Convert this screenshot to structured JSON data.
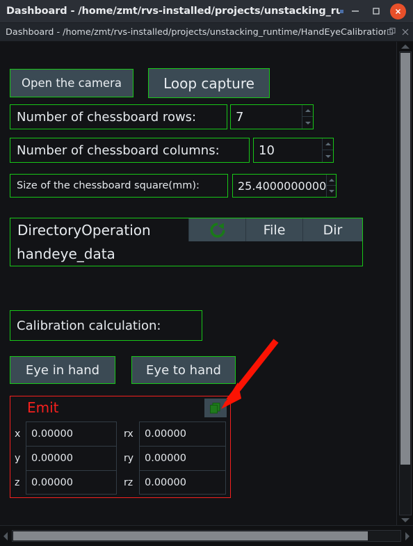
{
  "window": {
    "title": "Dashboard - /home/zmt/rvs-installed/projects/unstacking_runtime/...",
    "minimize_label": "minimize",
    "maximize_label": "maximize",
    "close_label": "close"
  },
  "dock": {
    "title": "Dashboard - /home/zmt/rvs-installed/projects/unstacking_runtime/HandEyeCalibration/Hand...",
    "float_label": "float",
    "close_label": "close"
  },
  "panel": {
    "open_camera_button": "Open the camera",
    "loop_capture_button": "Loop capture",
    "rows_label": "Number of chessboard rows:",
    "rows_value": "7",
    "columns_label": "Number of chessboard columns:",
    "columns_value": "10",
    "square_size_label": "Size of the chessboard square(mm):",
    "square_size_value": "25.4000000000",
    "directory": {
      "title": "DirectoryOperation",
      "refresh_label": "refresh",
      "file_button": "File",
      "dir_button": "Dir",
      "path_value": "handeye_data"
    },
    "calibration_label": "Calibration calculation:",
    "eye_in_hand_button": "Eye in hand",
    "eye_to_hand_button": "Eye to hand",
    "emit": {
      "title": "Emit",
      "copy_label": "copy",
      "fields": [
        {
          "key": "x",
          "value": "0.00000"
        },
        {
          "key": "y",
          "value": "0.00000"
        },
        {
          "key": "z",
          "value": "0.00000"
        },
        {
          "key": "rx",
          "value": "0.00000"
        },
        {
          "key": "ry",
          "value": "0.00000"
        },
        {
          "key": "rz",
          "value": "0.00000"
        }
      ]
    }
  },
  "colors": {
    "accent_green": "#18c718",
    "alert_red": "#f5201e",
    "button_face": "#3b4a54",
    "background": "#121316",
    "titlebar": "#2b2f36",
    "close_button": "#e8502a"
  }
}
